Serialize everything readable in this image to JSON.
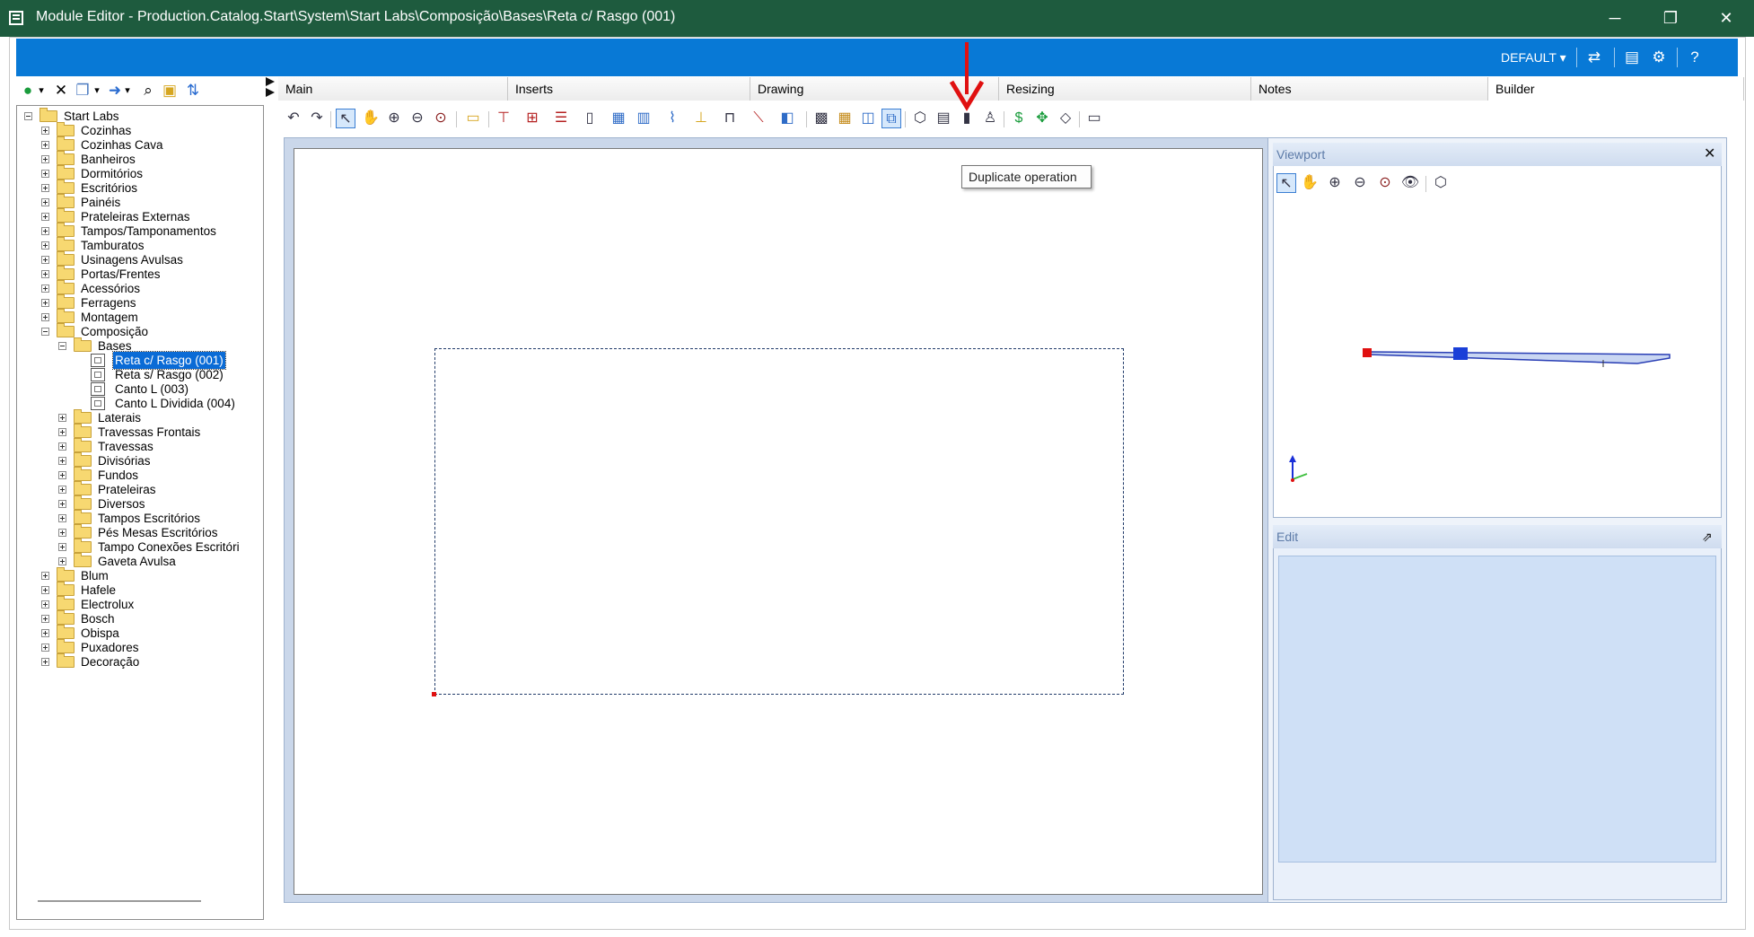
{
  "window": {
    "title": "Module Editor - Production.Catalog.Start\\System\\Start Labs\\Composição\\Bases\\Reta c/ Rasgo (001)",
    "minimize_icon": "─",
    "restore_icon": "❐",
    "close_icon": "✕"
  },
  "topbar": {
    "profile": "DEFAULT ▾",
    "icons": [
      "refresh-icon",
      "panel-icon",
      "settings-icon",
      "help-icon"
    ]
  },
  "tabs": [
    "Main",
    "Inserts",
    "Drawing",
    "Resizing",
    "Notes",
    "Builder"
  ],
  "tooltip": "Duplicate operation",
  "tree": [
    {
      "label": "Start Labs",
      "level": 0,
      "type": "folder",
      "expanded": true
    },
    {
      "label": "Cozinhas",
      "level": 1,
      "type": "folder",
      "expanded": false
    },
    {
      "label": "Cozinhas Cava",
      "level": 1,
      "type": "folder",
      "expanded": false
    },
    {
      "label": "Banheiros",
      "level": 1,
      "type": "folder",
      "expanded": false
    },
    {
      "label": "Dormitórios",
      "level": 1,
      "type": "folder",
      "expanded": false
    },
    {
      "label": "Escritórios",
      "level": 1,
      "type": "folder",
      "expanded": false
    },
    {
      "label": "Painéis",
      "level": 1,
      "type": "folder",
      "expanded": false
    },
    {
      "label": "Prateleiras Externas",
      "level": 1,
      "type": "folder",
      "expanded": false
    },
    {
      "label": "Tampos/Tamponamentos",
      "level": 1,
      "type": "folder",
      "expanded": false
    },
    {
      "label": "Tamburatos",
      "level": 1,
      "type": "folder",
      "expanded": false
    },
    {
      "label": "Usinagens Avulsas",
      "level": 1,
      "type": "folder",
      "expanded": false
    },
    {
      "label": "Portas/Frentes",
      "level": 1,
      "type": "folder",
      "expanded": false
    },
    {
      "label": "Acessórios",
      "level": 1,
      "type": "folder",
      "expanded": false
    },
    {
      "label": "Ferragens",
      "level": 1,
      "type": "folder",
      "expanded": false
    },
    {
      "label": "Montagem",
      "level": 1,
      "type": "folder",
      "expanded": false
    },
    {
      "label": "Composição",
      "level": 1,
      "type": "folder",
      "expanded": true
    },
    {
      "label": "Bases",
      "level": 2,
      "type": "folder",
      "expanded": true
    },
    {
      "label": "Reta c/ Rasgo (001)",
      "level": 3,
      "type": "doc",
      "selected": true
    },
    {
      "label": "Reta s/ Rasgo (002)",
      "level": 3,
      "type": "doc"
    },
    {
      "label": "Canto L (003)",
      "level": 3,
      "type": "doc"
    },
    {
      "label": "Canto L Dividida (004)",
      "level": 3,
      "type": "doc"
    },
    {
      "label": "Laterais",
      "level": 2,
      "type": "folder",
      "expanded": false
    },
    {
      "label": "Travessas Frontais",
      "level": 2,
      "type": "folder",
      "expanded": false
    },
    {
      "label": "Travessas",
      "level": 2,
      "type": "folder",
      "expanded": false
    },
    {
      "label": "Divisórias",
      "level": 2,
      "type": "folder",
      "expanded": false
    },
    {
      "label": "Fundos",
      "level": 2,
      "type": "folder",
      "expanded": false
    },
    {
      "label": "Prateleiras",
      "level": 2,
      "type": "folder",
      "expanded": false
    },
    {
      "label": "Diversos",
      "level": 2,
      "type": "folder",
      "expanded": false
    },
    {
      "label": "Tampos Escritórios",
      "level": 2,
      "type": "folder",
      "expanded": false
    },
    {
      "label": "Pés Mesas Escritórios",
      "level": 2,
      "type": "folder",
      "expanded": false
    },
    {
      "label": "Tampo Conexões Escritóri",
      "level": 2,
      "type": "folder",
      "expanded": false
    },
    {
      "label": "Gaveta Avulsa",
      "level": 2,
      "type": "folder",
      "expanded": false
    },
    {
      "label": "Blum",
      "level": 1,
      "type": "folder",
      "expanded": false
    },
    {
      "label": "Hafele",
      "level": 1,
      "type": "folder",
      "expanded": false
    },
    {
      "label": "Electrolux",
      "level": 1,
      "type": "folder",
      "expanded": false
    },
    {
      "label": "Bosch",
      "level": 1,
      "type": "folder",
      "expanded": false
    },
    {
      "label": "Obispa",
      "level": 1,
      "type": "folder",
      "expanded": false
    },
    {
      "label": "Puxadores",
      "level": 1,
      "type": "folder",
      "expanded": false
    },
    {
      "label": "Decoração",
      "level": 1,
      "type": "folder",
      "expanded": false
    }
  ],
  "viewport": {
    "title": "Viewport",
    "close": "✕"
  },
  "edit": {
    "title": "Edit",
    "pin": "⇗"
  },
  "colors": {
    "titlebar": "#1e5b3e",
    "band": "#0879d6",
    "selection": "#0a6bd6",
    "annotation_arrow": "#e01010"
  }
}
